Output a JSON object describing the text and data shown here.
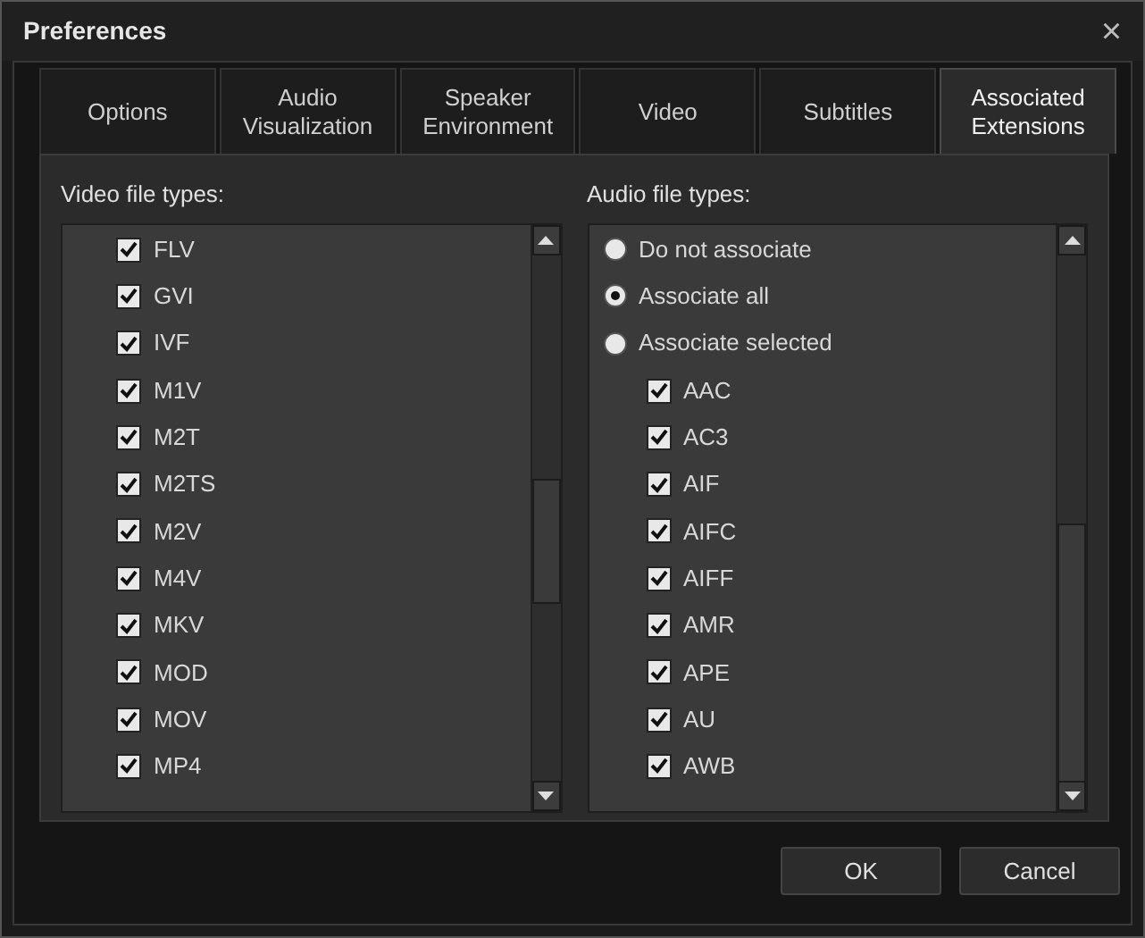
{
  "window": {
    "title": "Preferences",
    "close": "×"
  },
  "tabs": [
    {
      "label": "Options",
      "selected": false
    },
    {
      "label": "Audio\nVisualization",
      "selected": false
    },
    {
      "label": "Speaker\nEnvironment",
      "selected": false
    },
    {
      "label": "Video",
      "selected": false
    },
    {
      "label": "Subtitles",
      "selected": false
    },
    {
      "label": "Associated\nExtensions",
      "selected": true
    }
  ],
  "video": {
    "label": "Video file types:",
    "items": [
      {
        "label": "FLV",
        "checked": true
      },
      {
        "label": "GVI",
        "checked": true
      },
      {
        "label": "IVF",
        "checked": true
      },
      {
        "label": "M1V",
        "checked": true
      },
      {
        "label": "M2T",
        "checked": true
      },
      {
        "label": "M2TS",
        "checked": true
      },
      {
        "label": "M2V",
        "checked": true
      },
      {
        "label": "M4V",
        "checked": true
      },
      {
        "label": "MKV",
        "checked": true
      },
      {
        "label": "MOD",
        "checked": true
      },
      {
        "label": "MOV",
        "checked": true
      },
      {
        "label": "MP4",
        "checked": true
      }
    ]
  },
  "audio": {
    "label": "Audio file types:",
    "options": [
      {
        "label": "Do not associate",
        "selected": false
      },
      {
        "label": "Associate all",
        "selected": true
      },
      {
        "label": "Associate selected",
        "selected": false
      }
    ],
    "items": [
      {
        "label": "AAC",
        "checked": true
      },
      {
        "label": "AC3",
        "checked": true
      },
      {
        "label": "AIF",
        "checked": true
      },
      {
        "label": "AIFC",
        "checked": true
      },
      {
        "label": "AIFF",
        "checked": true
      },
      {
        "label": "AMR",
        "checked": true
      },
      {
        "label": "APE",
        "checked": true
      },
      {
        "label": "AU",
        "checked": true
      },
      {
        "label": "AWB",
        "checked": true
      }
    ]
  },
  "buttons": [
    "OK",
    "Cancel"
  ]
}
